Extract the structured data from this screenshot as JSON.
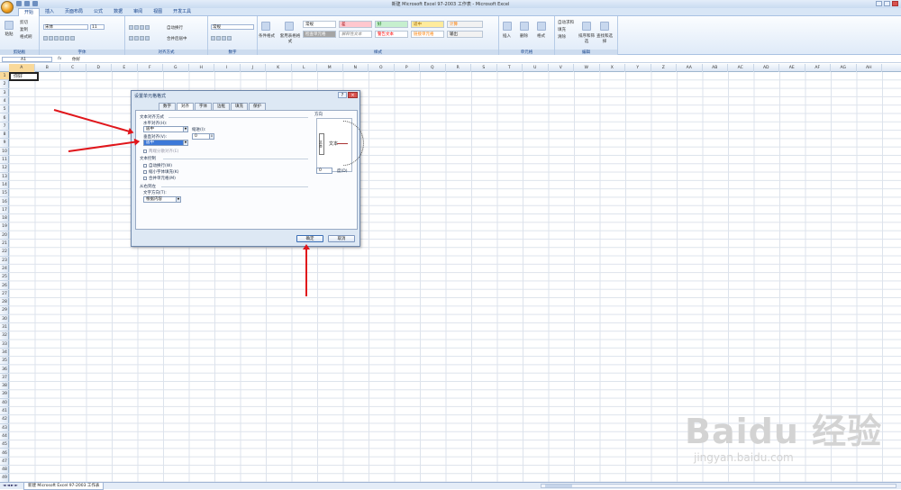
{
  "window": {
    "title": "新建 Microsoft Excel 97-2003 工作表 - Microsoft Excel"
  },
  "ribbon_tabs": [
    "开始",
    "插入",
    "页面布局",
    "公式",
    "数据",
    "审阅",
    "视图",
    "开发工具"
  ],
  "ribbon": {
    "clipboard": {
      "paste": "粘贴",
      "cut": "剪切",
      "copy": "复制",
      "format_painter": "格式刷",
      "label": "剪贴板"
    },
    "font": {
      "name": "宋体",
      "size": "11",
      "label": "字体"
    },
    "alignment": {
      "wrap": "自动换行",
      "merge": "合并后居中",
      "label": "对齐方式"
    },
    "number": {
      "format": "常规",
      "label": "数字"
    },
    "styles": {
      "conditional": "条件格式",
      "table": "套用表格格式",
      "cells": [
        "常规",
        "差",
        "好",
        "适中",
        "计算",
        "检查单元格",
        "解释性文本",
        "警告文本",
        "链接单元格",
        "输出"
      ],
      "label": "样式"
    },
    "cells": {
      "insert": "插入",
      "delete": "删除",
      "format": "格式",
      "label": "单元格"
    },
    "editing": {
      "autosum": "自动求和",
      "fill": "填充",
      "clear": "清除",
      "sort": "排序和筛选",
      "find": "查找和选择",
      "label": "编辑"
    }
  },
  "formula_bar": {
    "name_box": "A1",
    "fx": "fx",
    "content": "你好"
  },
  "columns": [
    "A",
    "B",
    "C",
    "D",
    "E",
    "F",
    "G",
    "H",
    "I",
    "J",
    "K",
    "L",
    "M",
    "N",
    "O",
    "P",
    "Q",
    "R",
    "S",
    "T",
    "U",
    "V",
    "W",
    "X",
    "Y",
    "Z",
    "AA",
    "AB",
    "AC",
    "AD",
    "AE",
    "AF",
    "AG",
    "AH"
  ],
  "rows": [
    "1",
    "2",
    "3",
    "4",
    "5",
    "6",
    "7",
    "8",
    "9",
    "10",
    "11",
    "12",
    "13",
    "14",
    "15",
    "16",
    "17",
    "18",
    "19",
    "20",
    "21",
    "22",
    "23",
    "24",
    "25",
    "26",
    "27",
    "28",
    "29",
    "30",
    "31",
    "32",
    "33",
    "34",
    "35",
    "36",
    "37",
    "38",
    "39",
    "40",
    "41",
    "42",
    "43",
    "44",
    "45",
    "46",
    "47",
    "48",
    "49"
  ],
  "cell_a1": "你好",
  "sheet_tab": "新建 Microsoft Excel 97-2003 工作表",
  "dialog": {
    "title": "设置单元格格式",
    "tabs": [
      "数字",
      "对齐",
      "字体",
      "边框",
      "填充",
      "保护"
    ],
    "text_align_heading": "文本对齐方式",
    "horizontal_label": "水平对齐(H):",
    "horizontal_value": "居中",
    "indent_label": "缩进(I):",
    "indent_value": "0",
    "vertical_label": "垂直对齐(V):",
    "vertical_value": "居中",
    "justify_distributed": "两端分散对齐(E)",
    "text_control_heading": "文本控制",
    "wrap_text": "自动换行(W)",
    "shrink_to_fit": "缩小字体填充(K)",
    "merge_cells": "合并单元格(M)",
    "rtl_heading": "从右到左",
    "text_direction_label": "文字方向(T):",
    "text_direction_value": "根据内容",
    "orientation_heading": "方向",
    "orientation_vertical": "文本",
    "orientation_text": "文本",
    "degrees_value": "0",
    "degrees_label": "度(D)",
    "ok": "确定",
    "cancel": "取消"
  },
  "watermark": {
    "logo": "Baidu 经验",
    "url": "jingyan.baidu.com"
  }
}
